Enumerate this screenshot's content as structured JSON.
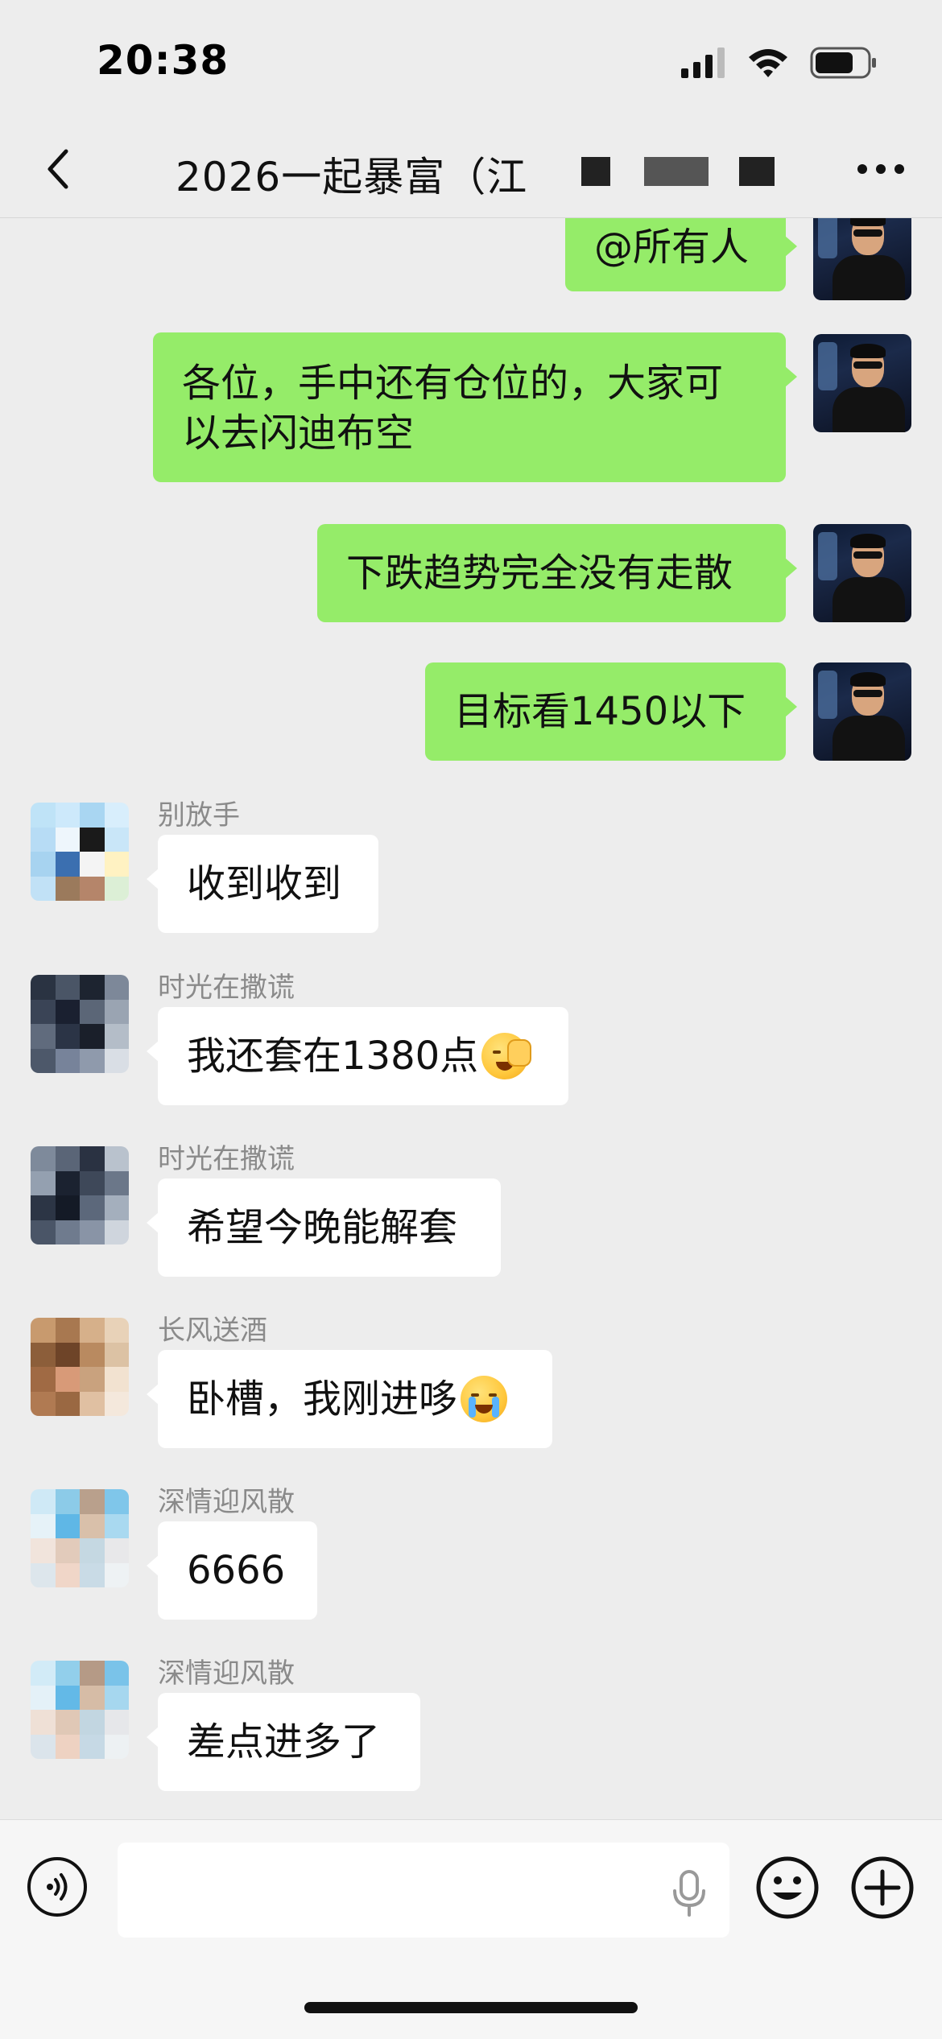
{
  "status_bar": {
    "time": "20:38"
  },
  "nav": {
    "title": "2026一起暴富（江"
  },
  "messages": [
    {
      "side": "right",
      "text": "@所有人"
    },
    {
      "side": "right",
      "text": "各位，手中还有仓位的，大家可以去闪迪布空"
    },
    {
      "side": "right",
      "text": "下跌趋势完全没有走散"
    },
    {
      "side": "right",
      "text": "目标看1450以下"
    },
    {
      "side": "left",
      "sender": "别放手",
      "text": "收到收到"
    },
    {
      "side": "left",
      "sender": "时光在撒谎",
      "text": "我还套在1380点",
      "emoji": "face-palm-emoji"
    },
    {
      "side": "left",
      "sender": "时光在撒谎",
      "text": "希望今晚能解套"
    },
    {
      "side": "left",
      "sender": "长风送酒",
      "text": "卧槽，我刚进哆",
      "emoji": "crying-face-emoji"
    },
    {
      "side": "left",
      "sender": "深情迎风散",
      "text": "6666"
    },
    {
      "side": "left",
      "sender": "深情迎风散",
      "text": "差点进多了"
    }
  ],
  "input_bar": {
    "text": "",
    "icons": [
      "voice-icon",
      "microphone-icon",
      "emoji-face-icon",
      "plus-icon"
    ]
  },
  "colors": {
    "sent_bubble": "#95ec69",
    "received_bubble": "#ffffff",
    "chat_background": "#ededed"
  }
}
